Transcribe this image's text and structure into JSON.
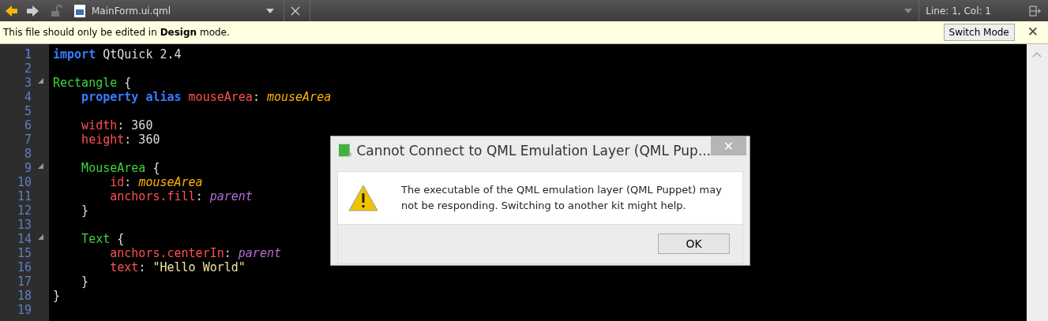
{
  "toolbar": {
    "file_name": "MainForm.ui.qml",
    "cursor_position": "Line: 1, Col: 1"
  },
  "info_bar": {
    "message": "This file should only be edited in **Design** mode.",
    "button": "Switch Mode",
    "close": "✕"
  },
  "editor": {
    "lines": [
      {
        "number": "1",
        "current": true,
        "foldable": false,
        "tokens": [
          {
            "kind": "keyword",
            "text": "import"
          },
          {
            "kind": "plain",
            "text": " QtQuick 2.4"
          }
        ]
      },
      {
        "number": "2",
        "current": false,
        "foldable": false
      },
      {
        "number": "3",
        "current": false,
        "foldable": true,
        "tokens": [
          {
            "kind": "type",
            "text": "Rectangle"
          },
          {
            "kind": "plain",
            "text": " {"
          }
        ]
      },
      {
        "number": "4",
        "current": false,
        "foldable": false,
        "tokens": [
          {
            "kind": "keyword",
            "text": "    property alias"
          },
          {
            "kind": "prop",
            "text": " mouseArea"
          },
          {
            "kind": "plain",
            "text": ": "
          },
          {
            "kind": "id",
            "text": "mouseArea"
          }
        ]
      },
      {
        "number": "5",
        "current": false,
        "foldable": false
      },
      {
        "number": "6",
        "current": false,
        "foldable": false,
        "tokens": [
          {
            "kind": "prop",
            "text": "    width"
          },
          {
            "kind": "plain",
            "text": ": 360"
          }
        ]
      },
      {
        "number": "7",
        "current": false,
        "foldable": false,
        "tokens": [
          {
            "kind": "prop",
            "text": "    height"
          },
          {
            "kind": "plain",
            "text": ": 360"
          }
        ]
      },
      {
        "number": "8",
        "current": false,
        "foldable": false
      },
      {
        "number": "9",
        "current": false,
        "foldable": true,
        "tokens": [
          {
            "kind": "type",
            "text": "    MouseArea"
          },
          {
            "kind": "plain",
            "text": " {"
          }
        ]
      },
      {
        "number": "10",
        "current": false,
        "foldable": false,
        "tokens": [
          {
            "kind": "prop",
            "text": "        id"
          },
          {
            "kind": "plain",
            "text": ": "
          },
          {
            "kind": "id",
            "text": "mouseArea"
          }
        ]
      },
      {
        "number": "11",
        "current": false,
        "foldable": false,
        "tokens": [
          {
            "kind": "prop",
            "text": "        anchors.fill"
          },
          {
            "kind": "plain",
            "text": ": "
          },
          {
            "kind": "parent",
            "text": "parent"
          }
        ]
      },
      {
        "number": "12",
        "current": false,
        "foldable": false,
        "tokens": [
          {
            "kind": "plain",
            "text": "    }"
          }
        ]
      },
      {
        "number": "13",
        "current": false,
        "foldable": false
      },
      {
        "number": "14",
        "current": false,
        "foldable": true,
        "tokens": [
          {
            "kind": "type",
            "text": "    Text"
          },
          {
            "kind": "plain",
            "text": " {"
          }
        ]
      },
      {
        "number": "15",
        "current": false,
        "foldable": false,
        "tokens": [
          {
            "kind": "prop",
            "text": "        anchors.centerIn"
          },
          {
            "kind": "plain",
            "text": ": "
          },
          {
            "kind": "parent",
            "text": "parent"
          }
        ]
      },
      {
        "number": "16",
        "current": false,
        "foldable": false,
        "tokens": [
          {
            "kind": "prop",
            "text": "        text"
          },
          {
            "kind": "plain",
            "text": ": "
          },
          {
            "kind": "string",
            "text": "\"Hello World\""
          }
        ]
      },
      {
        "number": "17",
        "current": false,
        "foldable": false,
        "tokens": [
          {
            "kind": "plain",
            "text": "    }"
          }
        ]
      },
      {
        "number": "18",
        "current": false,
        "foldable": false,
        "tokens": [
          {
            "kind": "plain",
            "text": "}"
          }
        ]
      },
      {
        "number": "19",
        "current": false,
        "foldable": false
      }
    ]
  },
  "dialog": {
    "title": "Cannot Connect to QML Emulation Layer (QML Pup...",
    "close": "✕",
    "message": "The executable of the QML emulation layer (QML Puppet) may not be responding. Switching to another kit might help.",
    "button": "OK"
  }
}
